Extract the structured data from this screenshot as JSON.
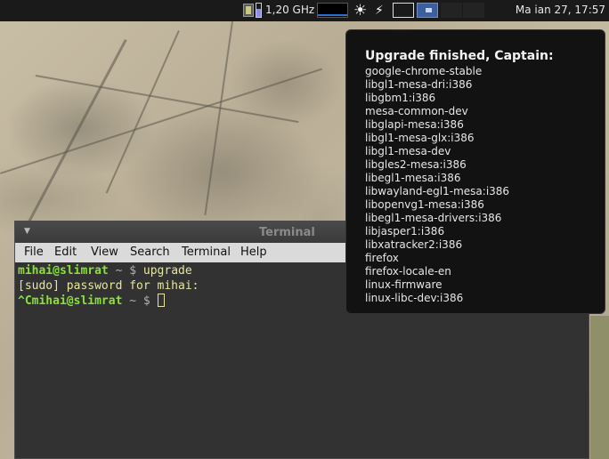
{
  "panel": {
    "cpu_freq": "1,20 GHz",
    "clock": "Ma ian 27, 17:57",
    "icons": [
      "cpu-icon",
      "battery-icon",
      "network-graph",
      "brightness-icon",
      "power-plug-icon"
    ],
    "workspaces": 4,
    "active_workspace": 2
  },
  "notification": {
    "title": "Upgrade finished, Captain:",
    "packages": [
      "google-chrome-stable",
      "libgl1-mesa-dri:i386",
      "libgbm1:i386",
      "mesa-common-dev",
      "libglapi-mesa:i386",
      "libgl1-mesa-glx:i386",
      "libgl1-mesa-dev",
      "libgles2-mesa:i386",
      "libegl1-mesa:i386",
      "libwayland-egl1-mesa:i386",
      "libopenvg1-mesa:i386",
      "libegl1-mesa-drivers:i386",
      "libjasper1:i386",
      "libxatracker2:i386",
      "firefox",
      "firefox-locale-en",
      "linux-firmware",
      "linux-libc-dev:i386"
    ]
  },
  "terminal": {
    "title": "Terminal",
    "menu": {
      "file": "File",
      "edit": "Edit",
      "view": "View",
      "search": "Search",
      "terminal": "Terminal",
      "help": "Help"
    },
    "lines": {
      "l1_prompt": "mihai@slimrat",
      "l1_sym": " ~ $ ",
      "l1_cmd": "upgrade",
      "l2": "[sudo] password for mihai:",
      "l3_prefix": "^C",
      "l3_prompt": "mihai@slimrat",
      "l3_sym": " ~ $ "
    }
  },
  "colors": {
    "prompt_green": "#8ae234",
    "command_yellow": "#e6e6a0",
    "notification_bg": "#121212",
    "panel_bg": "#1a1a1a",
    "workspace_active": "#3d5f9e"
  }
}
